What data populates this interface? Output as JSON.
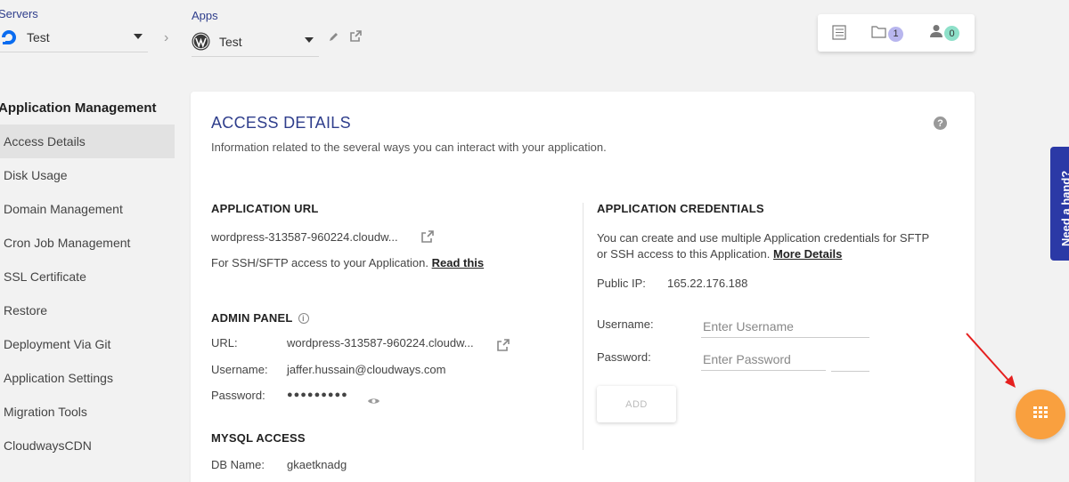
{
  "header": {
    "servers_label": "Servers",
    "server_name": "Test",
    "apps_label": "Apps",
    "app_name": "Test",
    "notification_count": "1",
    "team_count": "0"
  },
  "sidebar": {
    "title": "Application Management",
    "items": [
      {
        "label": "Access Details",
        "active": true
      },
      {
        "label": "Disk Usage"
      },
      {
        "label": "Domain Management"
      },
      {
        "label": "Cron Job Management"
      },
      {
        "label": "SSL Certificate"
      },
      {
        "label": "Restore"
      },
      {
        "label": "Deployment Via Git"
      },
      {
        "label": "Application Settings"
      },
      {
        "label": "Migration Tools"
      },
      {
        "label": "CloudwaysCDN"
      }
    ]
  },
  "main": {
    "title": "ACCESS DETAILS",
    "subtitle": "Information related to the several ways you can interact with your application.",
    "help_glyph": "?",
    "app_url": {
      "title": "APPLICATION URL",
      "url": "wordpress-313587-960224.cloudw...",
      "ssh_text": "For SSH/SFTP access to your Application.",
      "read_this": "Read this"
    },
    "admin": {
      "title": "ADMIN PANEL",
      "url_label": "URL:",
      "url_value": "wordpress-313587-960224.cloudw...",
      "username_label": "Username:",
      "username_value": "jaffer.hussain@cloudways.com",
      "password_label": "Password:",
      "password_value": "●●●●●●●●●"
    },
    "mysql": {
      "title": "MYSQL ACCESS",
      "db_label": "DB Name:",
      "db_value": "gkaetknadg"
    },
    "credentials": {
      "title": "APPLICATION CREDENTIALS",
      "desc_line1": "You can create and use multiple Application credentials for SFTP",
      "desc_line2": "or SSH access to this Application.",
      "more_details": "More Details",
      "public_ip_label": "Public IP:",
      "public_ip_value": "165.22.176.188",
      "username_label": "Username:",
      "username_placeholder": "Enter Username",
      "password_label": "Password:",
      "password_placeholder": "Enter Password",
      "add_label": "ADD"
    }
  },
  "side_tab": {
    "label": "Need a hand?"
  },
  "colors": {
    "accent": "#2f3e8c",
    "fab": "#f9a03f",
    "help_tab": "#2b39a6"
  }
}
